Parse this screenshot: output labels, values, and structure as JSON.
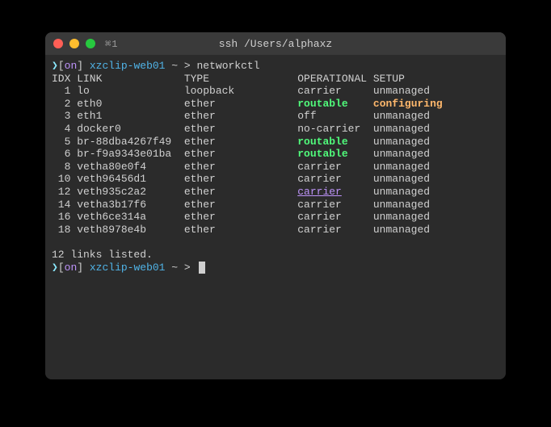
{
  "window": {
    "title": "ssh /Users/alphaxz",
    "extra": "⌘1"
  },
  "prompt": {
    "arrow": "❯",
    "open": "[",
    "on": "on",
    "close": "]",
    "host": "xzclip-web01",
    "tilde": "~",
    "gt": ">"
  },
  "cmd": "networkctl",
  "headers": {
    "idx": "IDX",
    "link": "LINK",
    "type": "TYPE",
    "operational": "OPERATIONAL",
    "setup": "SETUP"
  },
  "rows": [
    {
      "idx": "1",
      "link": "lo",
      "type": "loopback",
      "op": "carrier",
      "op_style": "",
      "setup": "unmanaged",
      "setup_style": ""
    },
    {
      "idx": "2",
      "link": "eth0",
      "type": "ether",
      "op": "routable",
      "op_style": "green",
      "setup": "configuring",
      "setup_style": "orange"
    },
    {
      "idx": "3",
      "link": "eth1",
      "type": "ether",
      "op": "off",
      "op_style": "",
      "setup": "unmanaged",
      "setup_style": ""
    },
    {
      "idx": "4",
      "link": "docker0",
      "type": "ether",
      "op": "no-carrier",
      "op_style": "",
      "setup": "unmanaged",
      "setup_style": ""
    },
    {
      "idx": "5",
      "link": "br-88dba4267f49",
      "type": "ether",
      "op": "routable",
      "op_style": "green",
      "setup": "unmanaged",
      "setup_style": ""
    },
    {
      "idx": "6",
      "link": "br-f9a9343e01ba",
      "type": "ether",
      "op": "routable",
      "op_style": "green",
      "setup": "unmanaged",
      "setup_style": ""
    },
    {
      "idx": "8",
      "link": "vetha80e0f4",
      "type": "ether",
      "op": "carrier",
      "op_style": "",
      "setup": "unmanaged",
      "setup_style": ""
    },
    {
      "idx": "10",
      "link": "veth96456d1",
      "type": "ether",
      "op": "carrier",
      "op_style": "",
      "setup": "unmanaged",
      "setup_style": ""
    },
    {
      "idx": "12",
      "link": "veth935c2a2",
      "type": "ether",
      "op": "carrier",
      "op_style": "underline",
      "setup": "unmanaged",
      "setup_style": ""
    },
    {
      "idx": "14",
      "link": "vetha3b17f6",
      "type": "ether",
      "op": "carrier",
      "op_style": "",
      "setup": "unmanaged",
      "setup_style": ""
    },
    {
      "idx": "16",
      "link": "veth6ce314a",
      "type": "ether",
      "op": "carrier",
      "op_style": "",
      "setup": "unmanaged",
      "setup_style": ""
    },
    {
      "idx": "18",
      "link": "veth8978e4b",
      "type": "ether",
      "op": "carrier",
      "op_style": "",
      "setup": "unmanaged",
      "setup_style": ""
    }
  ],
  "summary": "12 links listed.",
  "cols": {
    "idx": 3,
    "link": 17,
    "type": 18,
    "op": 12
  }
}
